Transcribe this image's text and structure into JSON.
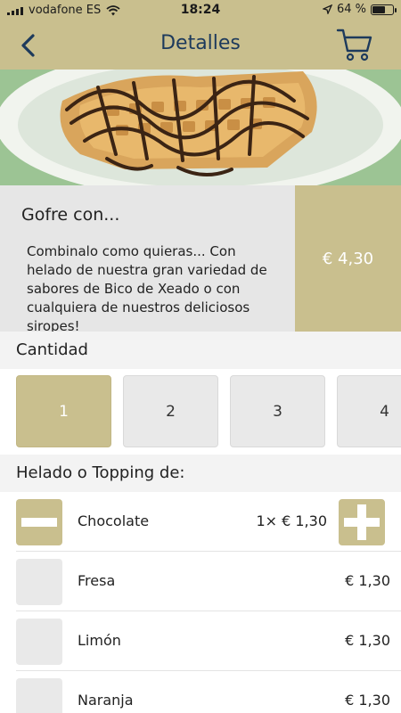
{
  "status_bar": {
    "carrier": "vodafone ES",
    "time": "18:24",
    "battery": "64 %",
    "battery_level": 0.64
  },
  "header": {
    "title": "Detalles",
    "back_icon": "chevron-left-icon",
    "cart_icon": "shopping-cart-icon"
  },
  "product": {
    "name": "Gofre con...",
    "description": "Combinalo como quieras... Con helado de nuestra gran variedad de sabores de Bico de Xeado o con cualquiera de nuestros deliciosos siropes!",
    "price": "€ 4,30"
  },
  "quantity": {
    "label": "Cantidad",
    "options": [
      "1",
      "2",
      "3",
      "4"
    ],
    "selected": "1"
  },
  "toppings": {
    "label": "Helado o Topping de:",
    "items": [
      {
        "name": "Chocolate",
        "price": "1× € 1,30",
        "selected": true
      },
      {
        "name": "Fresa",
        "price": "€ 1,30",
        "selected": false
      },
      {
        "name": "Limón",
        "price": "€ 1,30",
        "selected": false
      },
      {
        "name": "Naranja",
        "price": "€ 1,30",
        "selected": false
      }
    ]
  },
  "colors": {
    "accent": "#c9bf8e",
    "title": "#1d3a5c",
    "panel": "#e6e6e6"
  }
}
